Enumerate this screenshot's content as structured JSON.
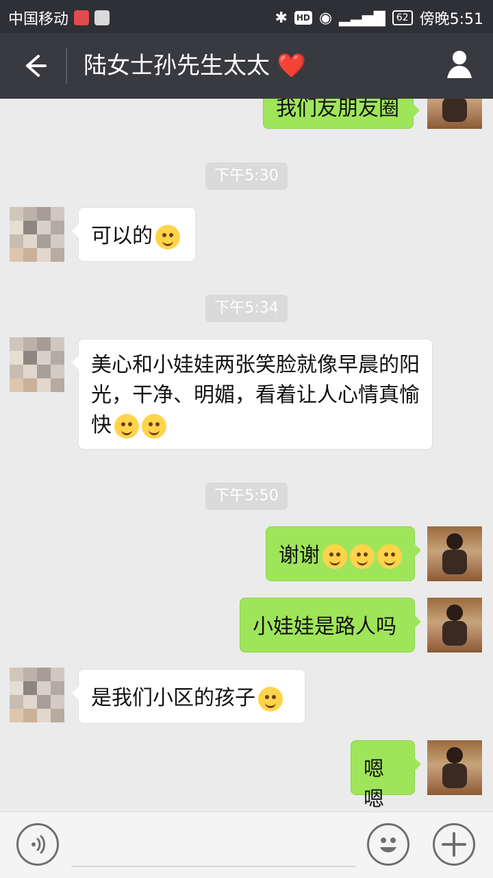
{
  "status_bar": {
    "carrier": "中国移动",
    "battery": "62",
    "time_text": "傍晚5:51",
    "icons": [
      "app-icon-red",
      "app-icon-gray",
      "bluetooth-icon",
      "hd-icon",
      "eye-icon",
      "signal-4g-icon",
      "battery-icon"
    ]
  },
  "header": {
    "title": "陆女士孙先生太太",
    "title_emoji": "❤️",
    "back_icon": "arrow-left-icon",
    "profile_icon": "person-icon"
  },
  "chat": {
    "partial_top_message": "我们友朋友圈",
    "timestamps": [
      "下午5:30",
      "下午5:34",
      "下午5:50"
    ],
    "messages": [
      {
        "side": "left",
        "text": "可以的",
        "emoji": [
          "smile-blush"
        ]
      },
      {
        "side": "left",
        "text": "美心和小娃娃两张笑脸就像早晨的阳光，干净、明媚，看着让人心情真愉快",
        "emoji": [
          "smile-blush",
          "smile-blush"
        ]
      },
      {
        "side": "right",
        "text": "谢谢",
        "emoji": [
          "grin",
          "grin",
          "grin"
        ]
      },
      {
        "side": "right",
        "text": "小娃娃是路人吗"
      },
      {
        "side": "left",
        "text": "是我们小区的孩子",
        "emoji": [
          "smile-blush"
        ]
      },
      {
        "side": "right",
        "text": "嗯嗯"
      }
    ]
  },
  "input_bar": {
    "voice_icon": "voice-wave-icon",
    "emoji_icon": "smile-face-icon",
    "plus_icon": "plus-icon"
  }
}
